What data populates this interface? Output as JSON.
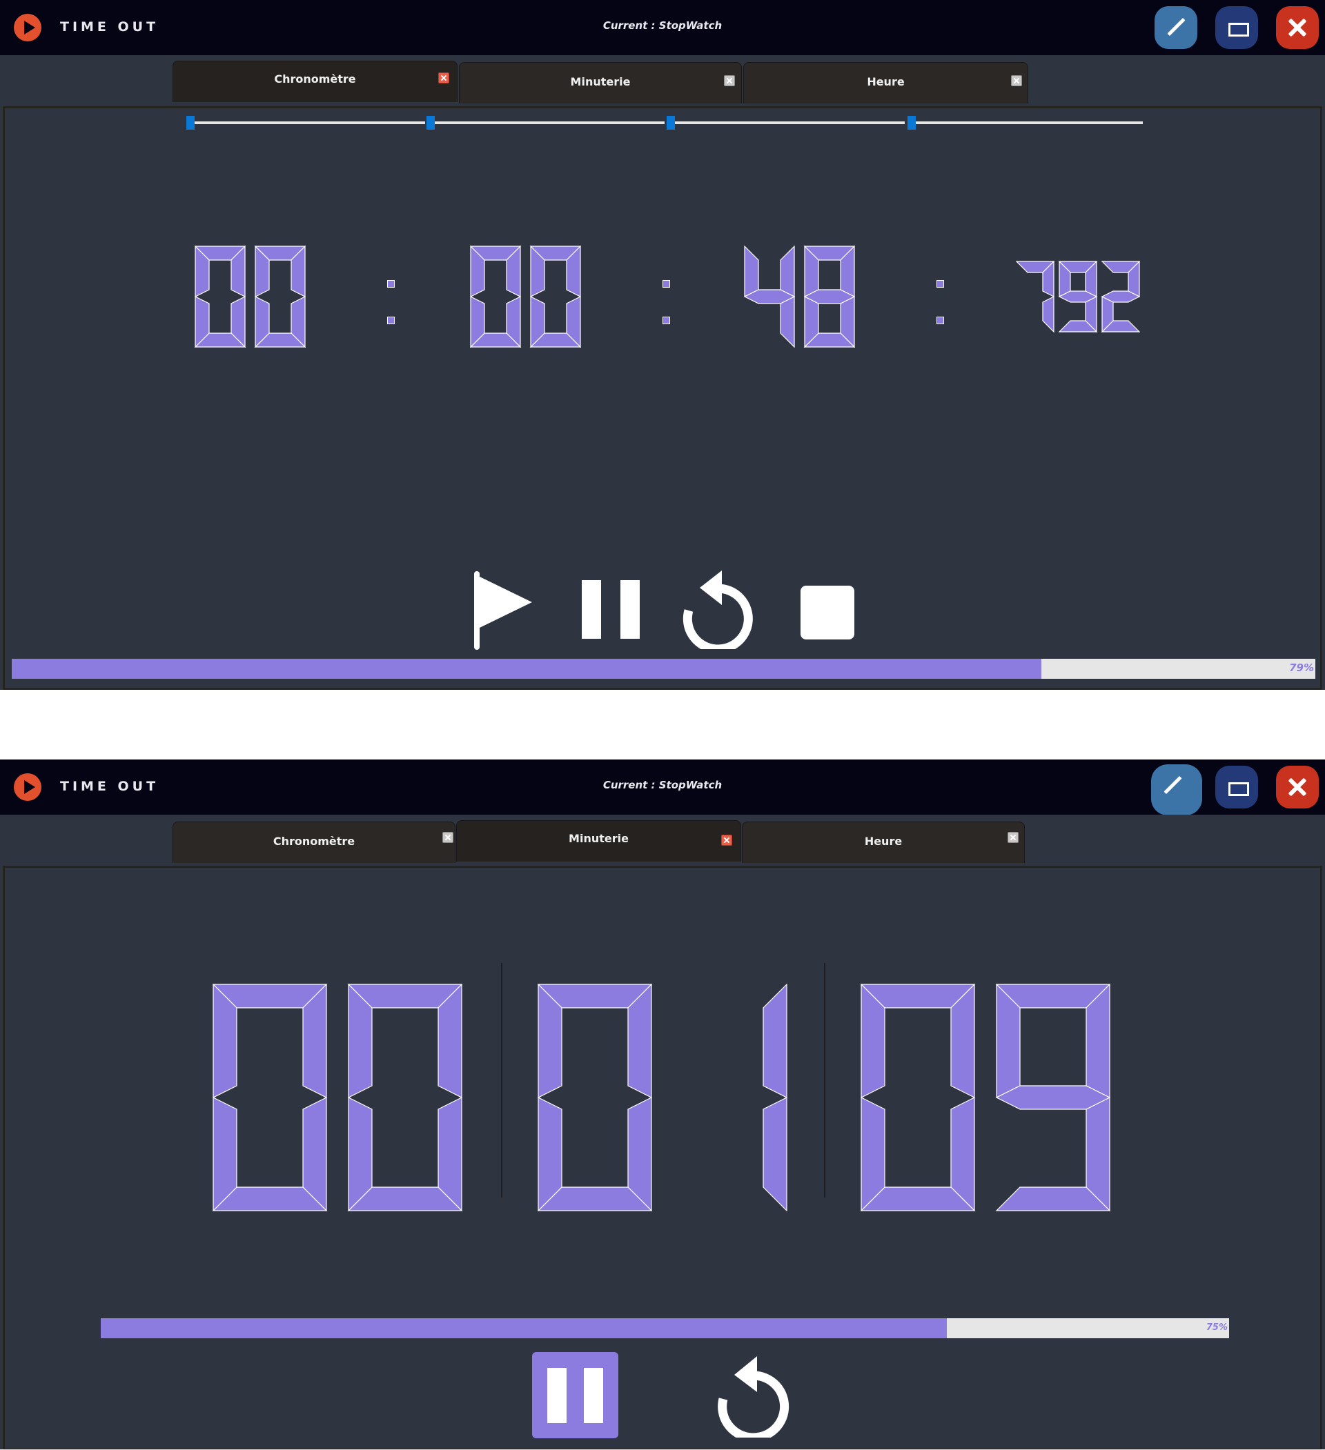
{
  "app": {
    "title": "TIME OUT",
    "current": "Current : StopWatch"
  },
  "tabs": [
    {
      "label": "Chronomètre"
    },
    {
      "label": "Minuterie"
    },
    {
      "label": "Heure"
    }
  ],
  "stopwatch": {
    "active_tab": "Chronomètre",
    "hours": "00",
    "minutes": "00",
    "seconds": "48",
    "milliseconds": "792",
    "separator": ":",
    "controls": [
      "flag-icon",
      "pause-icon",
      "restart-icon",
      "stop-icon"
    ],
    "progress_percent": 79,
    "progress_label": "79%"
  },
  "timer": {
    "active_tab": "Minuterie",
    "hours": "00",
    "minutes": "01",
    "seconds": "09",
    "controls": [
      "pause-icon",
      "restart-icon"
    ],
    "progress_percent": 75,
    "progress_label": "75%"
  },
  "colors": {
    "digit": "#8c7ce0",
    "background": "#2f3441",
    "titlebar": "#040414",
    "accent_close": "#c8321e",
    "accent_edit": "#3d74a8",
    "accent_max": "#243a78",
    "slider_thumb": "#0a78d7"
  }
}
